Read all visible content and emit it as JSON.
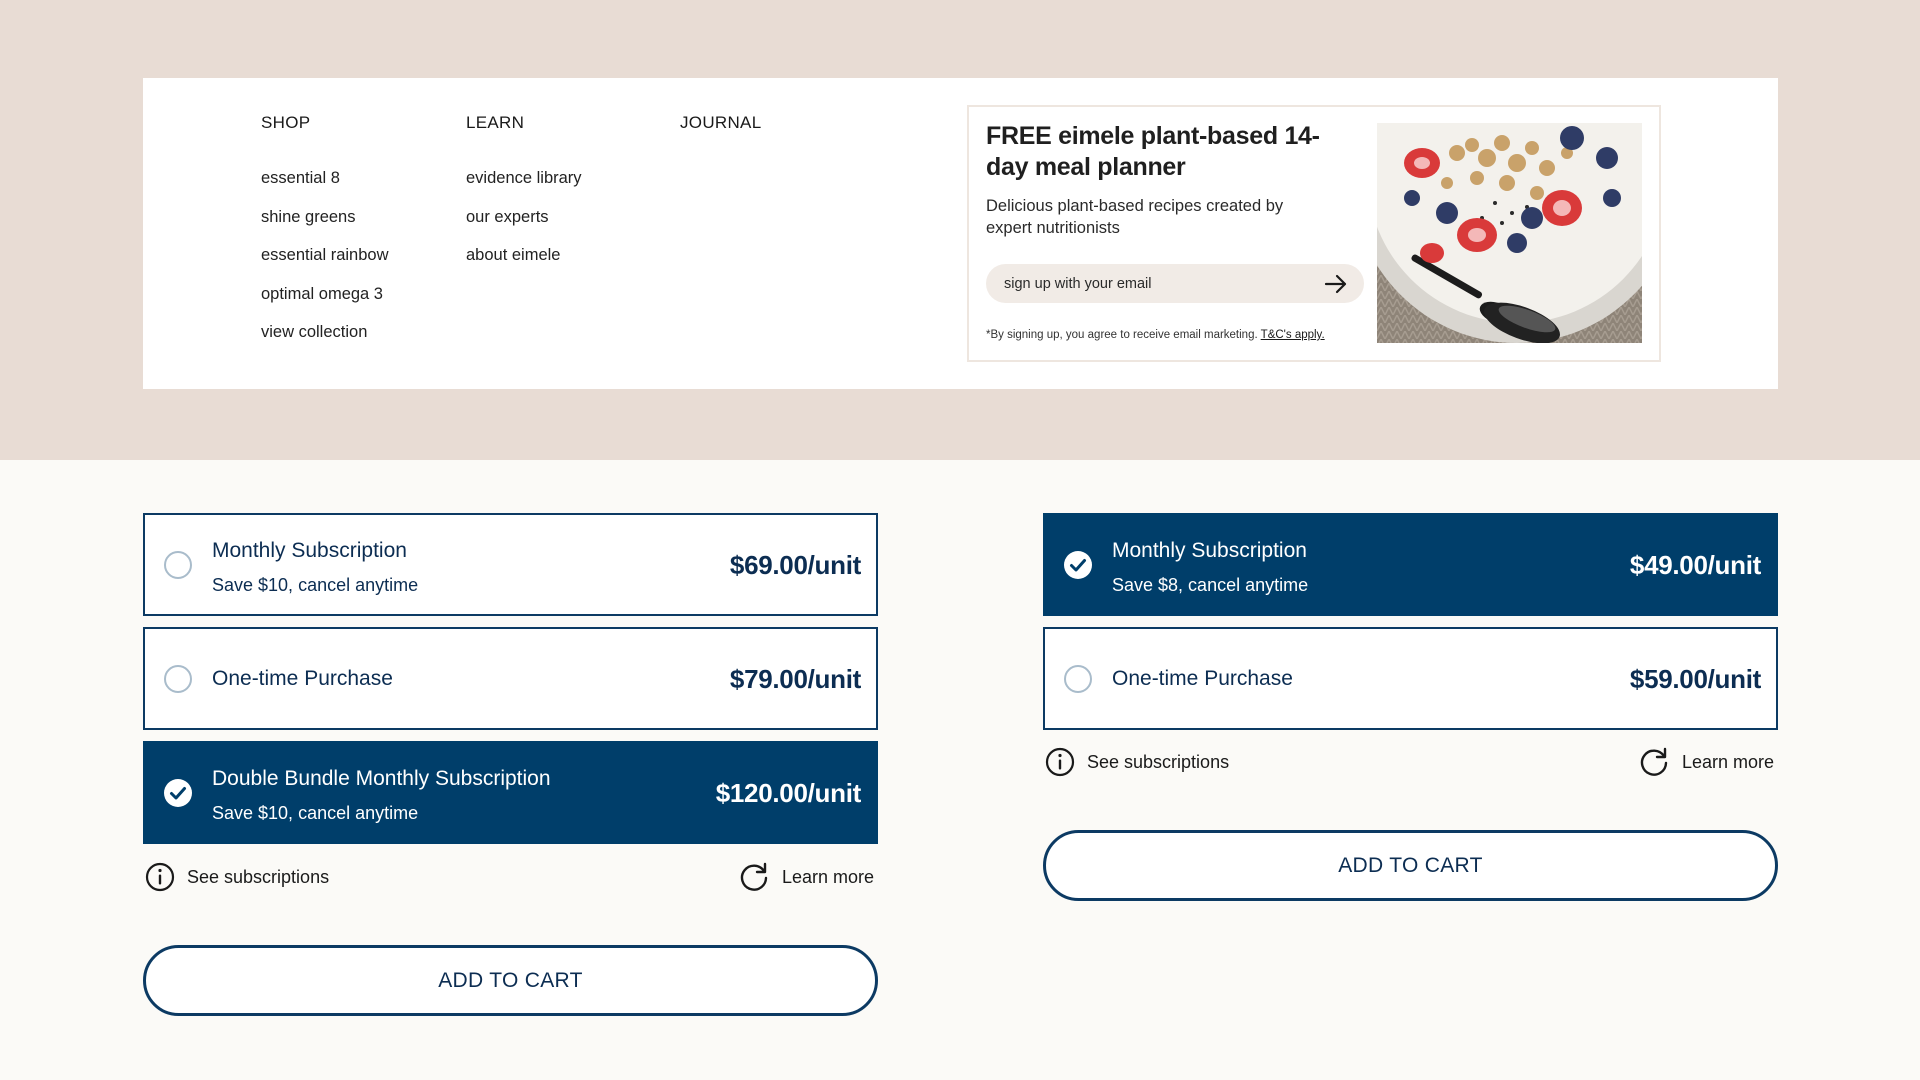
{
  "menu": {
    "columns": [
      {
        "heading": "SHOP",
        "items": [
          "essential 8",
          "shine greens",
          "essential rainbow",
          "optimal omega 3",
          "view collection"
        ]
      },
      {
        "heading": "LEARN",
        "items": [
          "evidence library",
          "our experts",
          "about eimele"
        ]
      },
      {
        "heading": "JOURNAL",
        "items": []
      }
    ]
  },
  "promo": {
    "title": "FREE eimele plant-based 14-day meal planner",
    "subtitle": "Delicious plant-based recipes created by expert nutritionists",
    "email_placeholder": "sign up with your email",
    "legal": "*By signing up, you agree to receive email marketing.",
    "legal_link": "T&C's apply.",
    "submit_icon": "arrow-right-icon",
    "image_icon": "yogurt-bowl-image"
  },
  "left_panel": {
    "options": [
      {
        "title": "Monthly Subscription",
        "subtitle": "Save $10, cancel anytime",
        "price": "$69.00/unit",
        "selected": false
      },
      {
        "title": "One-time Purchase",
        "subtitle": "",
        "price": "$79.00/unit",
        "selected": false
      },
      {
        "title": "Double Bundle Monthly Subscription",
        "subtitle": "Save $10, cancel anytime",
        "price": "$120.00/unit",
        "selected": true
      }
    ],
    "see_subscriptions": "See subscriptions",
    "learn_more": "Learn more",
    "add_to_cart": "ADD TO CART"
  },
  "right_panel": {
    "options": [
      {
        "title": "Monthly Subscription",
        "subtitle": "Save $8, cancel anytime",
        "price": "$49.00/unit",
        "selected": true
      },
      {
        "title": "One-time Purchase",
        "subtitle": "",
        "price": "$59.00/unit",
        "selected": false
      }
    ],
    "see_subscriptions": "See subscriptions",
    "learn_more": "Learn more",
    "add_to_cart": "ADD TO CART"
  },
  "colors": {
    "brand_navy": "#003e6a",
    "top_band": "#e8dcd4",
    "page_bg": "#fbfaf7",
    "input_bg": "#f1ebe6"
  },
  "icons": {
    "info": "info-circle-icon",
    "refresh": "refresh-icon",
    "check": "check-circle-icon"
  }
}
